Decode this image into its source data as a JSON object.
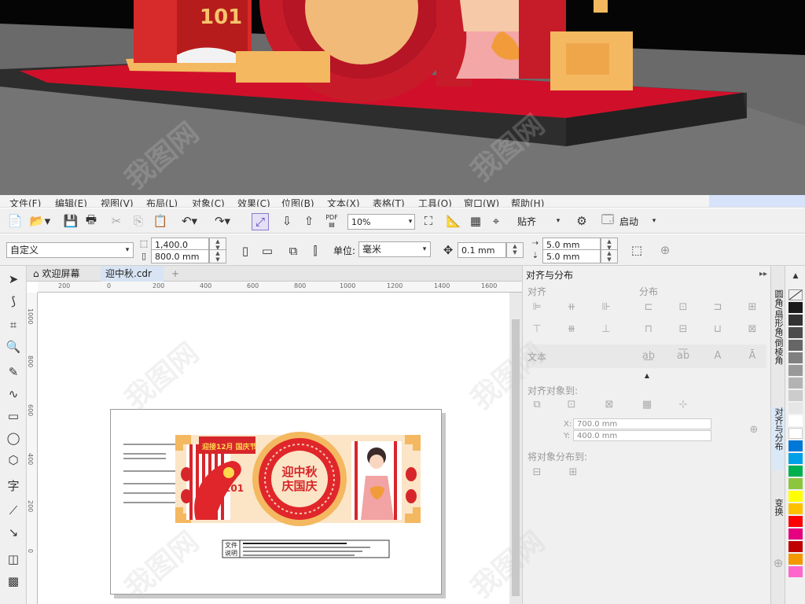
{
  "watermark": "我图网",
  "menus": [
    "文件(F)",
    "编辑(E)",
    "视图(V)",
    "布局(L)",
    "对象(C)",
    "效果(C)",
    "位图(B)",
    "文本(X)",
    "表格(T)",
    "工具(O)",
    "窗口(W)",
    "帮助(H)"
  ],
  "toolbar": {
    "pdf_label": "PDF",
    "zoom_value": "10%",
    "snap_label": "贴齐",
    "launch_label": "启动"
  },
  "propbar": {
    "preset_value": "自定义",
    "width_value": "1,400.0 mm",
    "height_value": "800.0 mm",
    "units_label": "单位:",
    "units_value": "毫米",
    "nudge_value": "0.1 mm",
    "dup_x": "5.0 mm",
    "dup_y": "5.0 mm"
  },
  "tabs": {
    "welcome": "欢迎屏幕",
    "document": "迎中秋.cdr",
    "add": "+"
  },
  "ruler": {
    "h_numbers": [
      "200",
      "0",
      "200",
      "400",
      "600",
      "800",
      "1000",
      "1200",
      "1400",
      "1600"
    ],
    "v_numbers": [
      "1000",
      "800",
      "600",
      "400",
      "200",
      "0"
    ]
  },
  "artwork": {
    "main_title": "迎中秋",
    "sub_title": "庆国庆",
    "badge_text": "迎接12月 国庆节",
    "number": "101",
    "info_label_1": "文件",
    "info_label_2": "说明"
  },
  "docker": {
    "title": "对齐与分布",
    "align_section": "对齐",
    "distribute_section": "分布",
    "text_section": "文本",
    "align_to_label": "对齐对象到:",
    "x_label": "X:",
    "x_value": "700.0 mm",
    "y_label": "Y:",
    "y_value": "400.0 mm",
    "distribute_to_label": "将对象分布到:"
  },
  "side_tabs": {
    "tab1": "圆角/扇形角/倒棱角",
    "tab2": "对齐与分布",
    "tab3": "变换"
  },
  "palette": {
    "colors": [
      "#ffffff",
      "#1a1a1a",
      "#333333",
      "#4d4d4d",
      "#666666",
      "#808080",
      "#999999",
      "#b3b3b3",
      "#cccccc",
      "#e6e6e6",
      "#ffffff",
      "#0078d7",
      "#00a0e9",
      "#00b050",
      "#8cc63f",
      "#ffff00",
      "#ffc000",
      "#ff0000",
      "#e4007f",
      "#c00000",
      "#f39800",
      "#ff66cc"
    ]
  }
}
